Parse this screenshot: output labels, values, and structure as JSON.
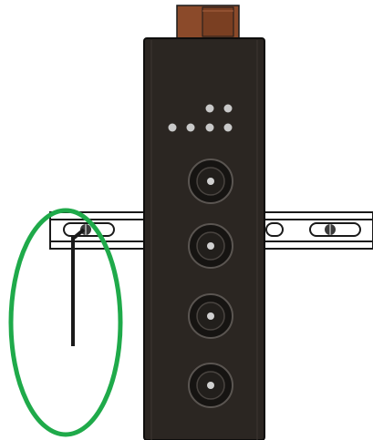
{
  "scene": {
    "subject": "din-rail-mounted-module",
    "connector_count": 4,
    "indicator_dot_count": 6,
    "colors": {
      "background": "#ffffff",
      "device_body": "#2b2622",
      "terminal_block": "#8b4a2a",
      "rail": "#ffffff",
      "highlight_ellipse": "#1faa4a",
      "connector": "#161412",
      "indicator": "#c9c9c9"
    }
  }
}
